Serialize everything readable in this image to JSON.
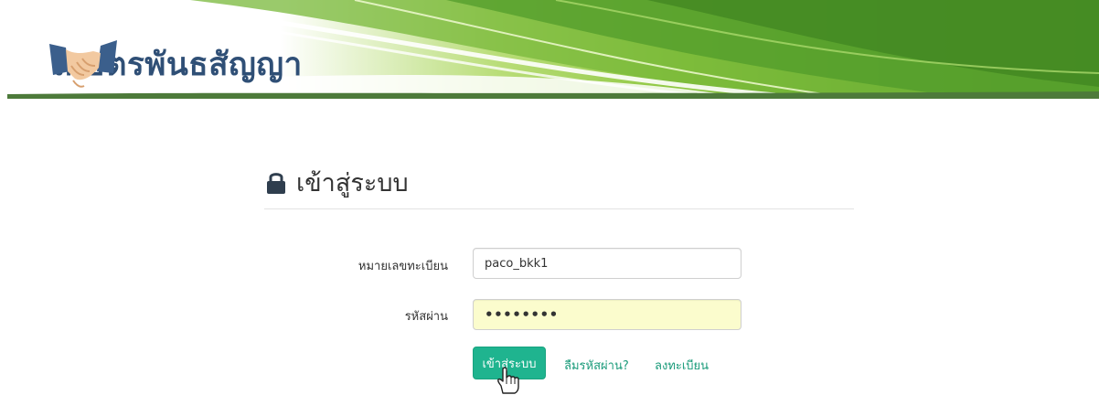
{
  "header": {
    "site_title": "เกษตรพันธสัญญา",
    "logo_icon": "handshake-icon"
  },
  "login": {
    "heading": "เข้าสู่ระบบ",
    "heading_icon": "lock-icon",
    "username_label": "หมายเลขทะเบียน",
    "username_value": "paco_bkk1",
    "password_label": "รหัสผ่าน",
    "password_value": "••••••••",
    "submit_label": "เข้าสู่ระบบ",
    "forgot_password_link": "ลืมรหัสผ่าน?",
    "register_link": "ลงทะเบียน"
  },
  "colors": {
    "brand_text": "#2f4f76",
    "primary_button": "#1fb48f",
    "link": "#1a9b7a",
    "password_field_bg": "#fbfccd",
    "banner_green": "#8cc63f"
  }
}
